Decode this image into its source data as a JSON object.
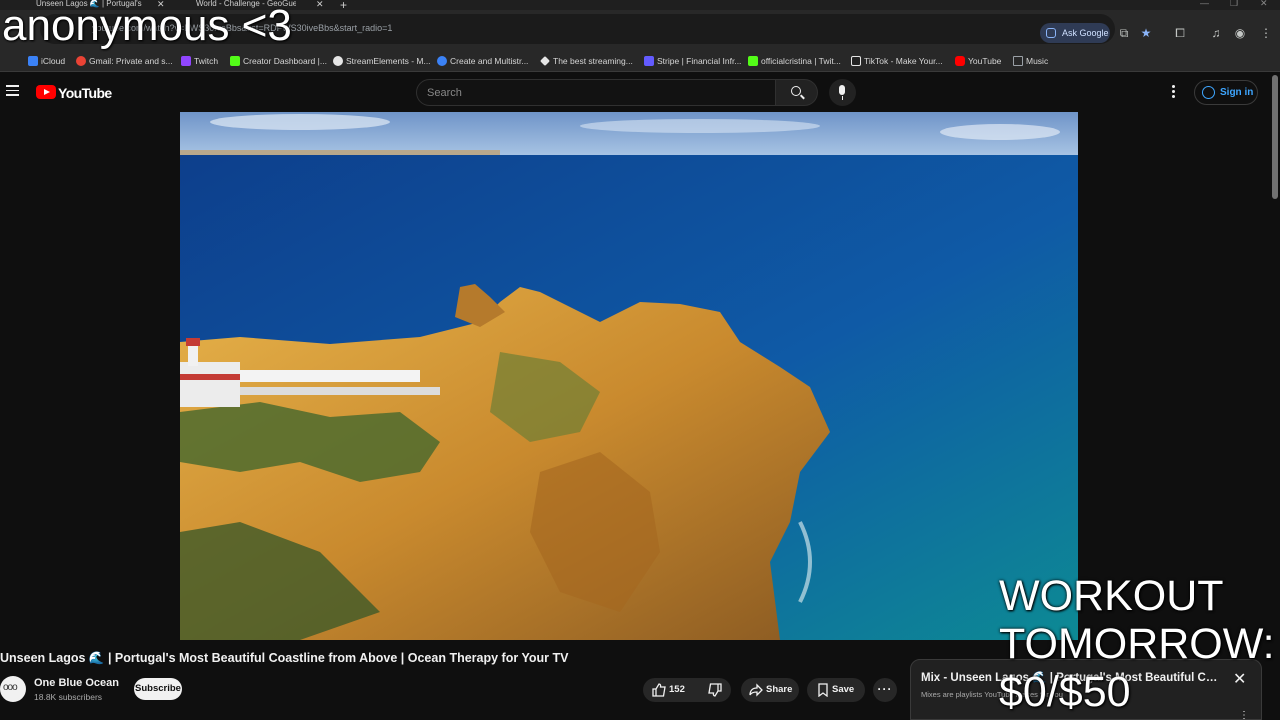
{
  "browser": {
    "tabs": [
      {
        "label": "Unseen Lagos 🌊 | Portugal's"
      },
      {
        "label": "World - Challenge - GeoGuessr"
      }
    ],
    "url": "youtube.com/watch?v=FWS30iveBbs&list=RDFWS30iveBbs&start_radio=1",
    "ask_google_label": "Ask Google"
  },
  "bookmarks": [
    {
      "label": "iCloud",
      "color": "#3b82f6"
    },
    {
      "label": "Gmail: Private and s...",
      "color": "#ea4335"
    },
    {
      "label": "Twitch",
      "color": "#9146ff"
    },
    {
      "label": "Creator Dashboard |...",
      "color": "#53fc18"
    },
    {
      "label": "StreamElements - M...",
      "color": "#e5e5e5"
    },
    {
      "label": "Create and Multistr...",
      "color": "#3b82f6"
    },
    {
      "label": "The best streaming...",
      "color": "#e5e5e5"
    },
    {
      "label": "Stripe | Financial Infr...",
      "color": "#635bff"
    },
    {
      "label": "officialcristina | Twit...",
      "color": "#53fc18"
    },
    {
      "label": "TikTok - Make Your...",
      "color": "#e5e5e5"
    },
    {
      "label": "YouTube",
      "color": "#ff0000"
    },
    {
      "label": "Music",
      "color": "#9aa0a6"
    }
  ],
  "header": {
    "logo_text": "YouTube",
    "search_placeholder": "Search",
    "sign_in_label": "Sign in"
  },
  "overlay": {
    "streamer_name": "anonymous <3",
    "goal_line1": "WORKOUT",
    "goal_line2": "TOMORROW:",
    "goal_line3": "$0/$50"
  },
  "video": {
    "title": "Unseen Lagos 🌊 | Portugal's Most Beautiful Coastline from Above | Ocean Therapy for Your TV",
    "channel_name": "One Blue Ocean",
    "subscribers": "18.8K subscribers",
    "subscribe_label": "Subscribe",
    "likes": "152",
    "share_label": "Share",
    "save_label": "Save",
    "more_label": "···"
  },
  "mix": {
    "title": "Mix - Unseen Lagos 🌊 | Portugal's Most Beautiful Coastline from Above | Ocean Therapy for Your TV",
    "subtitle": "Mixes are playlists YouTube makes for you",
    "close_label": "✕",
    "menu_label": "⋮"
  }
}
